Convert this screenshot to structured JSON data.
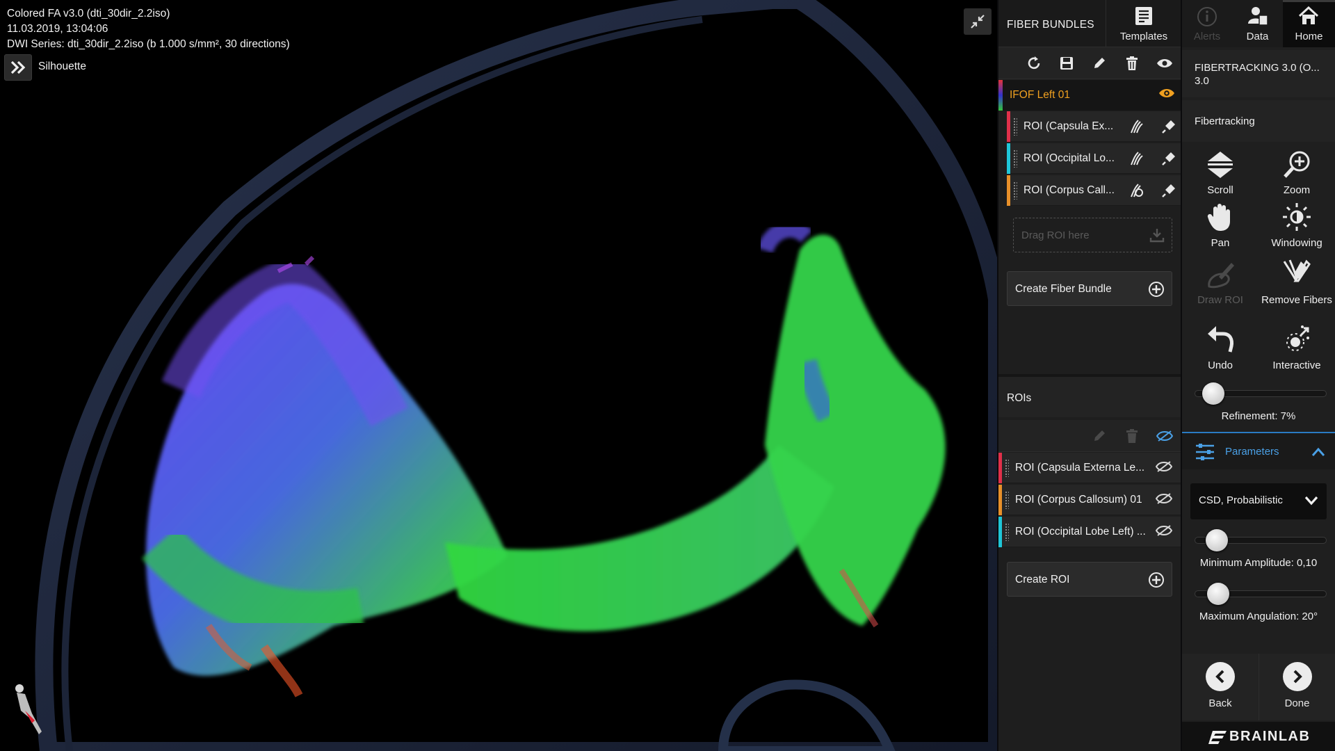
{
  "viewer": {
    "info_line1": "Colored FA v3.0 (dti_30dir_2.2iso)",
    "info_line2": "11.03.2019, 13:04:06",
    "info_line3": "DWI Series: dti_30dir_2.2iso (b 1.000 s/mm², 30 directions)",
    "silhouette_label": "Silhouette"
  },
  "fiber_bundles": {
    "title": "FIBER BUNDLES",
    "templates_label": "Templates",
    "bundle_name": "IFOF Left 01",
    "bundle_rois": [
      {
        "label": "ROI (Capsula Ex...",
        "color": "#e0304a"
      },
      {
        "label": "ROI (Occipital Lo...",
        "color": "#1fc6d8"
      },
      {
        "label": "ROI (Corpus Call...",
        "color": "#e8902a"
      }
    ],
    "drag_placeholder": "Drag ROI here",
    "create_bundle_label": "Create Fiber Bundle"
  },
  "rois": {
    "title": "ROIs",
    "items": [
      {
        "label": "ROI (Capsula Externa Le...",
        "color": "#e0304a"
      },
      {
        "label": "ROI (Corpus Callosum) 01",
        "color": "#e8902a"
      },
      {
        "label": "ROI (Occipital Lobe Left) ...",
        "color": "#1fc6d8"
      }
    ],
    "create_roi_label": "Create ROI"
  },
  "nav": {
    "alerts": "Alerts",
    "data": "Data",
    "home": "Home"
  },
  "panel": {
    "title": "FIBERTRACKING 3.0 (O... 3.0",
    "subtitle": "Fibertracking",
    "tools": {
      "scroll": "Scroll",
      "zoom": "Zoom",
      "pan": "Pan",
      "windowing": "Windowing",
      "draw_roi": "Draw ROI",
      "remove_fibers": "Remove Fibers",
      "undo": "Undo",
      "interactive": "Interactive"
    },
    "refinement": {
      "label": "Refinement: 7%",
      "value": 0.07
    },
    "parameters_label": "Parameters",
    "algorithm": "CSD, Probabilistic",
    "min_amplitude": {
      "label": "Minimum Amplitude: 0,10",
      "value": 0.1
    },
    "max_angulation": {
      "label": "Maximum Angulation: 20°",
      "value": 20
    },
    "back": "Back",
    "done": "Done",
    "brand": "BRAINLAB"
  },
  "colors": {
    "accent_orange": "#f0a020",
    "accent_blue": "#4aa0e6"
  }
}
